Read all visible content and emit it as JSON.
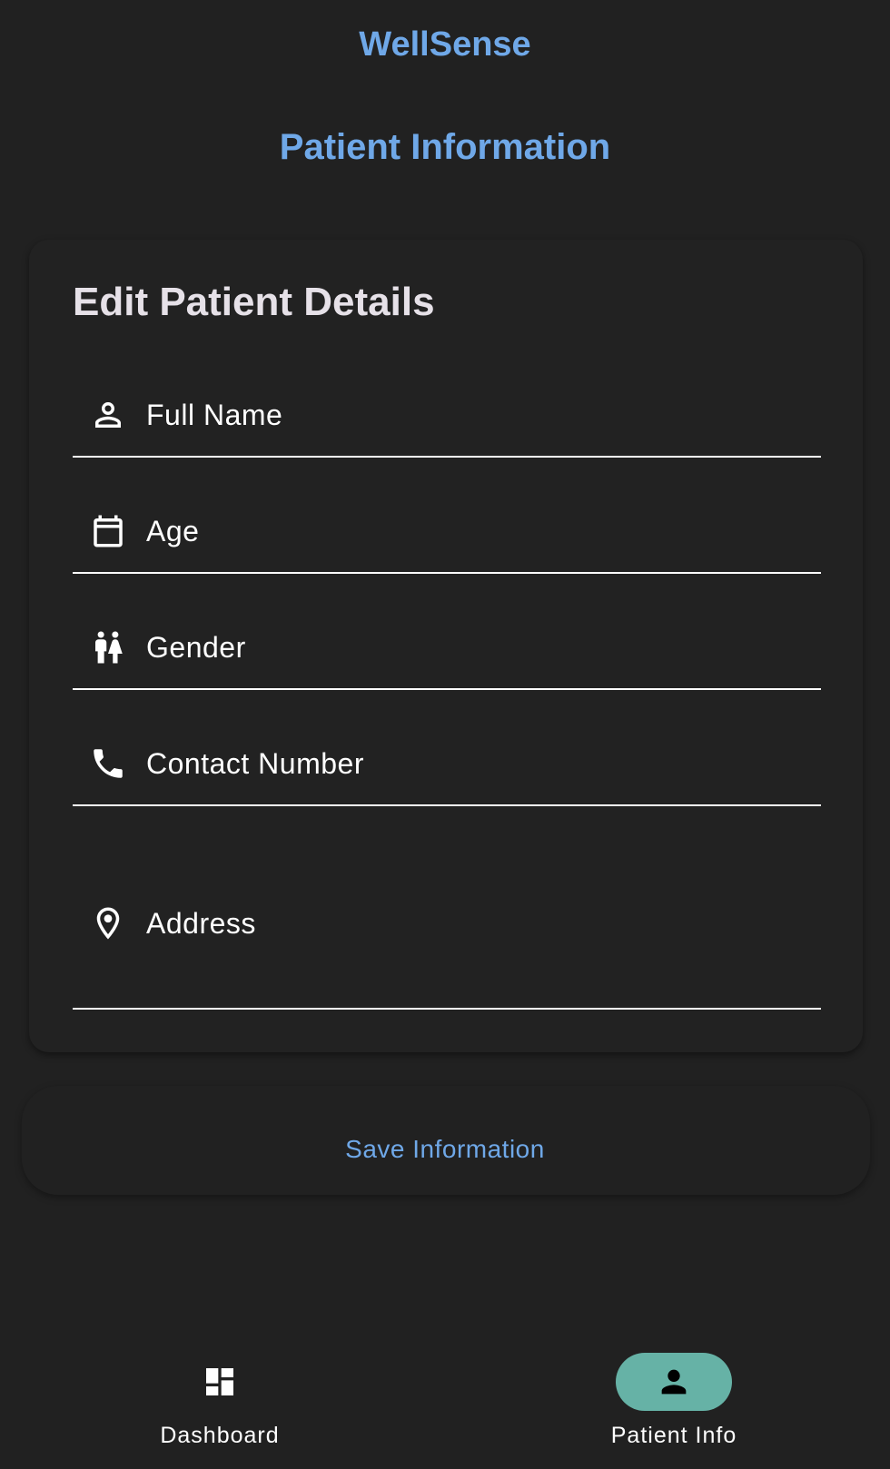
{
  "app": {
    "title": "WellSense"
  },
  "page": {
    "title": "Patient Information"
  },
  "form": {
    "title": "Edit Patient Details",
    "fields": [
      {
        "label": "Full Name",
        "icon": "person-outline-icon"
      },
      {
        "label": "Age",
        "icon": "calendar-icon"
      },
      {
        "label": "Gender",
        "icon": "wc-icon"
      },
      {
        "label": "Contact Number",
        "icon": "phone-icon"
      },
      {
        "label": "Address",
        "icon": "location-pin-icon"
      }
    ],
    "save_label": "Save Information"
  },
  "nav": {
    "items": [
      {
        "label": "Dashboard",
        "icon": "dashboard-icon",
        "active": false
      },
      {
        "label": "Patient Info",
        "icon": "person-icon",
        "active": true
      }
    ]
  },
  "colors": {
    "background": "#212121",
    "accent": "#6fa8e8",
    "nav_active_indicator": "#66b2a6"
  }
}
